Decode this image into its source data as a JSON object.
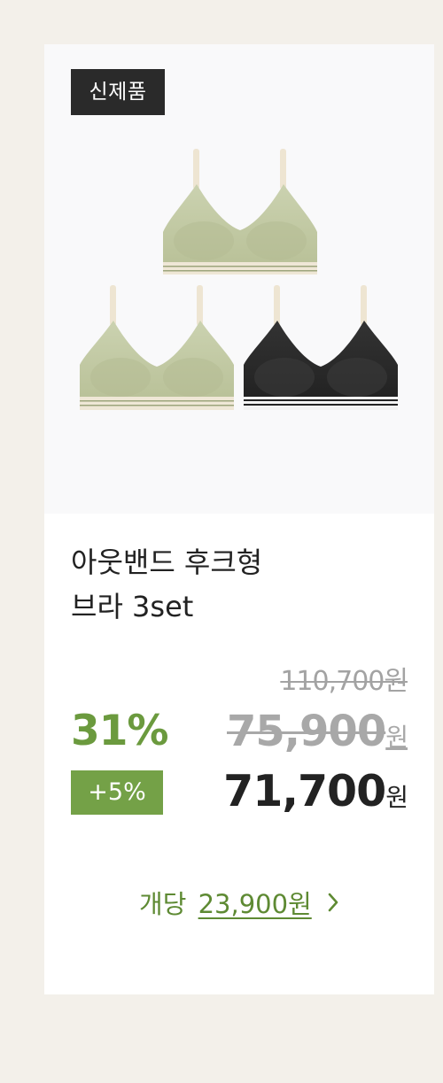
{
  "card": {
    "badge": "신제품",
    "image_alt": "아웃밴드 후크형 브라 3set",
    "title_line1": "아웃밴드 후크형",
    "title_line2": "브라 3set",
    "original_price": "110,700원",
    "discount_rate": "31%",
    "sale_price": "75,900",
    "sale_price_unit": "원",
    "extra_discount": "+5%",
    "final_price": "71,700",
    "final_price_unit": "원",
    "per_unit_label": "개당",
    "per_unit_price": "23,900원",
    "per_unit_icon": "chevron-right-icon"
  },
  "colors": {
    "background": "#f3f0ea",
    "accent_green": "#6b9a3e",
    "badge_dark": "#2a2a2a",
    "extra_badge_green": "#74a147",
    "product_olive": "#c5ccaa",
    "product_black": "#2b2b2b",
    "strap_cream": "#efe7d6"
  }
}
